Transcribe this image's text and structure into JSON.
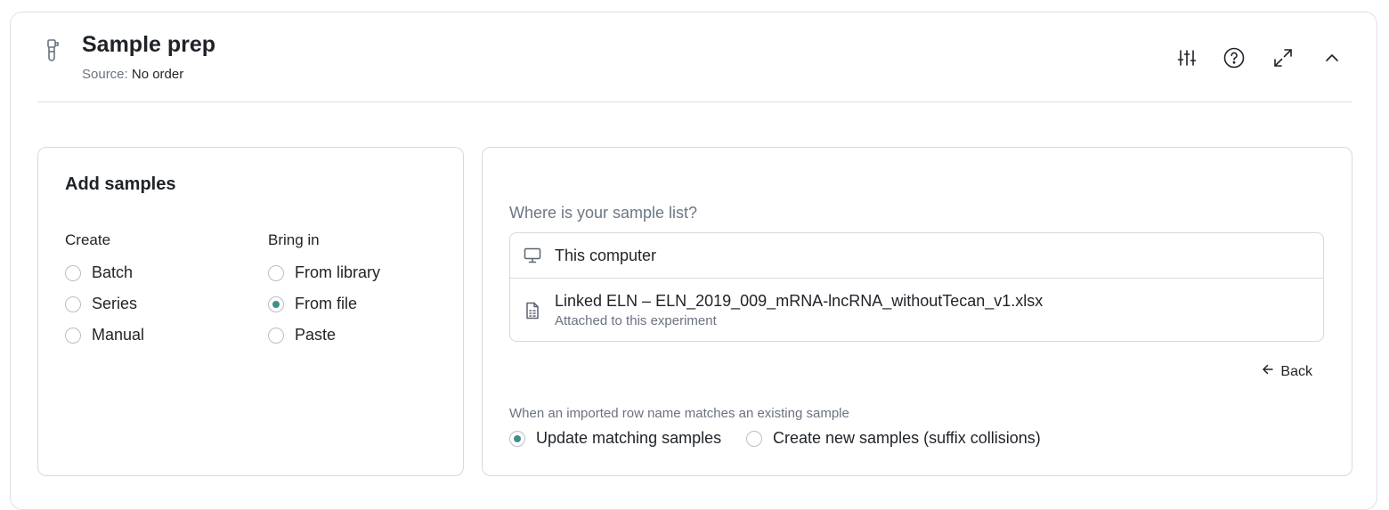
{
  "header": {
    "title": "Sample prep",
    "source_label": "Source:",
    "source_value": "No order",
    "icons": [
      "sliders-icon",
      "help-circle-icon",
      "expand-icon",
      "chevron-up-icon"
    ]
  },
  "add_samples": {
    "title": "Add samples",
    "create": {
      "label": "Create",
      "options": [
        "Batch",
        "Series",
        "Manual"
      ]
    },
    "bring_in": {
      "label": "Bring in",
      "options": [
        "From library",
        "From file",
        "Paste"
      ],
      "selected": "From file"
    }
  },
  "source_panel": {
    "question": "Where is your sample list?",
    "options": [
      {
        "icon": "monitor-icon",
        "label": "This computer"
      },
      {
        "icon": "spreadsheet-file-icon",
        "label": "Linked ELN – ELN_2019_009_mRNA-lncRNA_withoutTecan_v1.xlsx",
        "sublabel": "Attached to this experiment"
      }
    ],
    "back_label": "Back",
    "match_label": "When an imported row name matches an existing sample",
    "match_options": [
      "Update matching samples",
      "Create new samples (suffix collisions)"
    ],
    "match_selected": "Update matching samples"
  },
  "colors": {
    "accent": "#3f8f86",
    "border": "#d6d9dd",
    "muted": "#6b7280"
  }
}
